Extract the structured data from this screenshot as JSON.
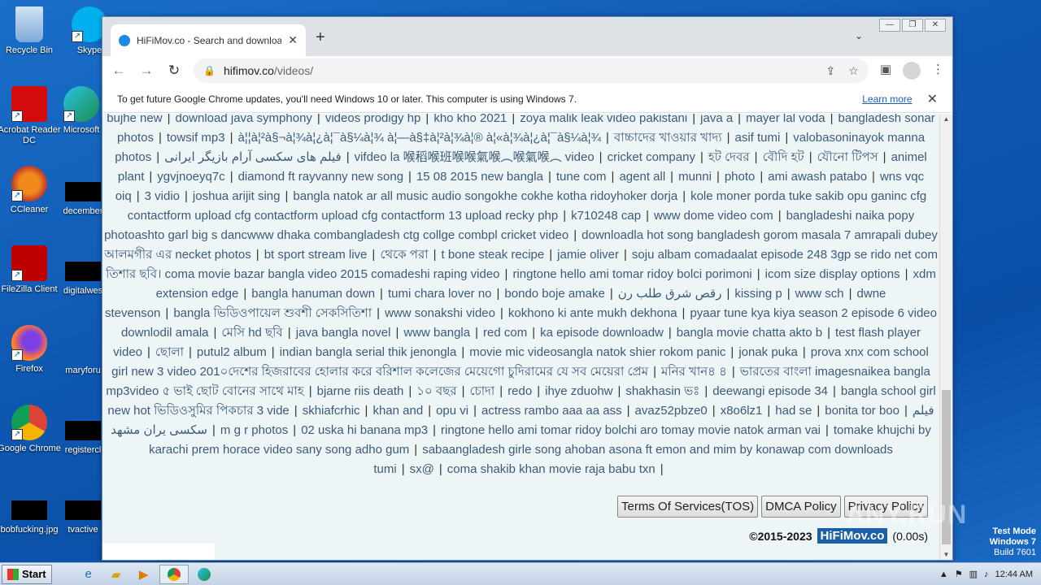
{
  "desktop": {
    "icons": [
      {
        "label": "Recycle Bin"
      },
      {
        "label": "Skype"
      },
      {
        "label": "Acrobat Reader DC"
      },
      {
        "label": "Microsoft"
      },
      {
        "label": "CCleaner"
      },
      {
        "label": "december"
      },
      {
        "label": "FileZilla Client"
      },
      {
        "label": "digitalwes"
      },
      {
        "label": "Firefox"
      },
      {
        "label": "maryforu"
      },
      {
        "label": "Google Chrome"
      },
      {
        "label": "registercl"
      },
      {
        "label": "bobfucking.jpg"
      },
      {
        "label": "tvactive"
      }
    ]
  },
  "browser": {
    "tab_title": "HiFiMov.co - Search and download",
    "url_host": "hifimov.co",
    "url_path": "/videos/",
    "infobar_text": "To get future Google Chrome updates, you'll need Windows 10 or later. This computer is using Windows 7.",
    "infobar_link": "Learn more"
  },
  "tags": [
    "bujhe new",
    "download java symphony",
    "videos prodigy hp",
    "kho kho 2021",
    "zoya malik leak video pakistani",
    "java a",
    "mayer lal voda",
    "bangladesh sonar photos",
    "towsif mp3",
    "à¦¦à¦²à§¬à¦¾à¦¿à¦¯à§¼à¦¾ à¦—à§‡à¦²à¦¾à¦® à¦«à¦¾à¦¿à¦¯à§¼à¦¾",
    "বাচ্চাদের খাওয়ার খাদ্য",
    "asif tumi",
    "valobasoninayok manna photos",
    "فیلم های سکسی آرام بازیگر ایرانی",
    "vifdeo la 喉稻喉班喉喉氣喉︵喉氣喉︵ video",
    "cricket company",
    "হট দেবর",
    "বৌদি হট",
    "যৌনো টিপস",
    "animel plant",
    "ygvjnoeyq7c",
    "diamond ft rayvanny new song",
    "15 08 2015 new bangla",
    "tune com",
    "agent all",
    "munni",
    "photo",
    "ami awash patabo",
    "wns vqc oiq",
    "3 vidio",
    "joshua arijit sing",
    "bangla natok ar all music audio songokhe cokhe kotha ridoyhoker dorja",
    "kole moner porda tuke sakib opu ganinc cfg contactform upload cfg contactform upload cfg contactform 13 upload recky php",
    "k710248 cap",
    "www dome video com",
    "bangladeshi naika popy photoashto garl big s dancwww dhaka combangladesh ctg collge combpl cricket video",
    "downloadla hot song bangladesh gorom masala 7 amrapali dubey আলমগীর এর necket photos",
    "bt sport stream live",
    "থেকে পরা",
    "t bone steak recipe",
    "jamie oliver",
    "soju albam comadaalat episode 248 3gp se rido net com তিশার ছবি। coma movie bazar bangla video 2015 comadeshi raping video",
    "ringtone hello ami tomar ridoy bolci porimoni",
    "icom size display options",
    "xdm extension edge",
    "bangla hanuman down",
    "tumi chara lover no",
    "bondo boje amake",
    "رقص شرق طلب رن",
    "kissing p",
    "www sch",
    "dwne stevenson",
    "bangla ভিডিওপায়েল শুবশী সেকসিতিশা",
    "www sonakshi video",
    "kokhono ki ante mukh dekhona",
    "pyaar tune kya kiya season 2 episode 6 video downlodil amala",
    "মেসি hd ছবি",
    "java bangla novel",
    "www bangla",
    "red com",
    "ka episode downloadw",
    "bangla movie chatta akto b",
    "test flash player video",
    "ছোলা",
    "putul2 album",
    "indian bangla serial thik jenongla",
    "movie mic videosangla natok shier rokom panic",
    "jonak puka",
    "prova xnx com school girl new 3 video 201০দেশের হিজরাবের হোলার করে বরিশাল কলেজের মেয়েগো চুদিরামের যে সব মেয়েরা প্রেম",
    "মনির খান৪ ৪",
    "ভারতের বাংলা imagesnaikea bangla mp3video ৫ ভাই ছোট বোনের সাথে মাহ",
    "bjarne riis death",
    "১০ বছর",
    "চোদা",
    "redo",
    "ihye zduohw",
    "shakhasin ভঃ",
    "deewangi episode 34",
    "bangla school girl new hot ভিডিওসুমির পিকচার 3 vide",
    "skhiafcrhic",
    "khan and",
    "opu vi",
    "actress rambo aaa aa ass",
    "avaz52pbze0",
    "x8o6lz1",
    "had se",
    "bonita tor boo",
    "فیلم سکسی یران مشهد",
    "m g r photos",
    "02 uska hi banana mp3",
    "ringtone hello ami tomar ridoy bolchi aro tomay movie natok arman vai",
    "tomake khujchi by karachi prem horace video sany song adho gum",
    "sabaangladesh girle song ahoban asona ft emon and mim by konawap com downloads tumi",
    "sx@",
    "coma shakib khan movie raja babu txn"
  ],
  "footer": {
    "tos": "Terms Of Services(TOS)",
    "dmca": "DMCA Policy",
    "privacy": "Privacy Policy",
    "copyright": "©2015-2023",
    "logo": "HiFiMov.co",
    "timing": "(0.00s)"
  },
  "watermark": "ANY.RUN",
  "testmode": {
    "line1": "Test Mode",
    "line2": "Windows 7",
    "line3": "Build 7601"
  },
  "taskbar": {
    "start": "Start",
    "time": "12:44 AM"
  }
}
